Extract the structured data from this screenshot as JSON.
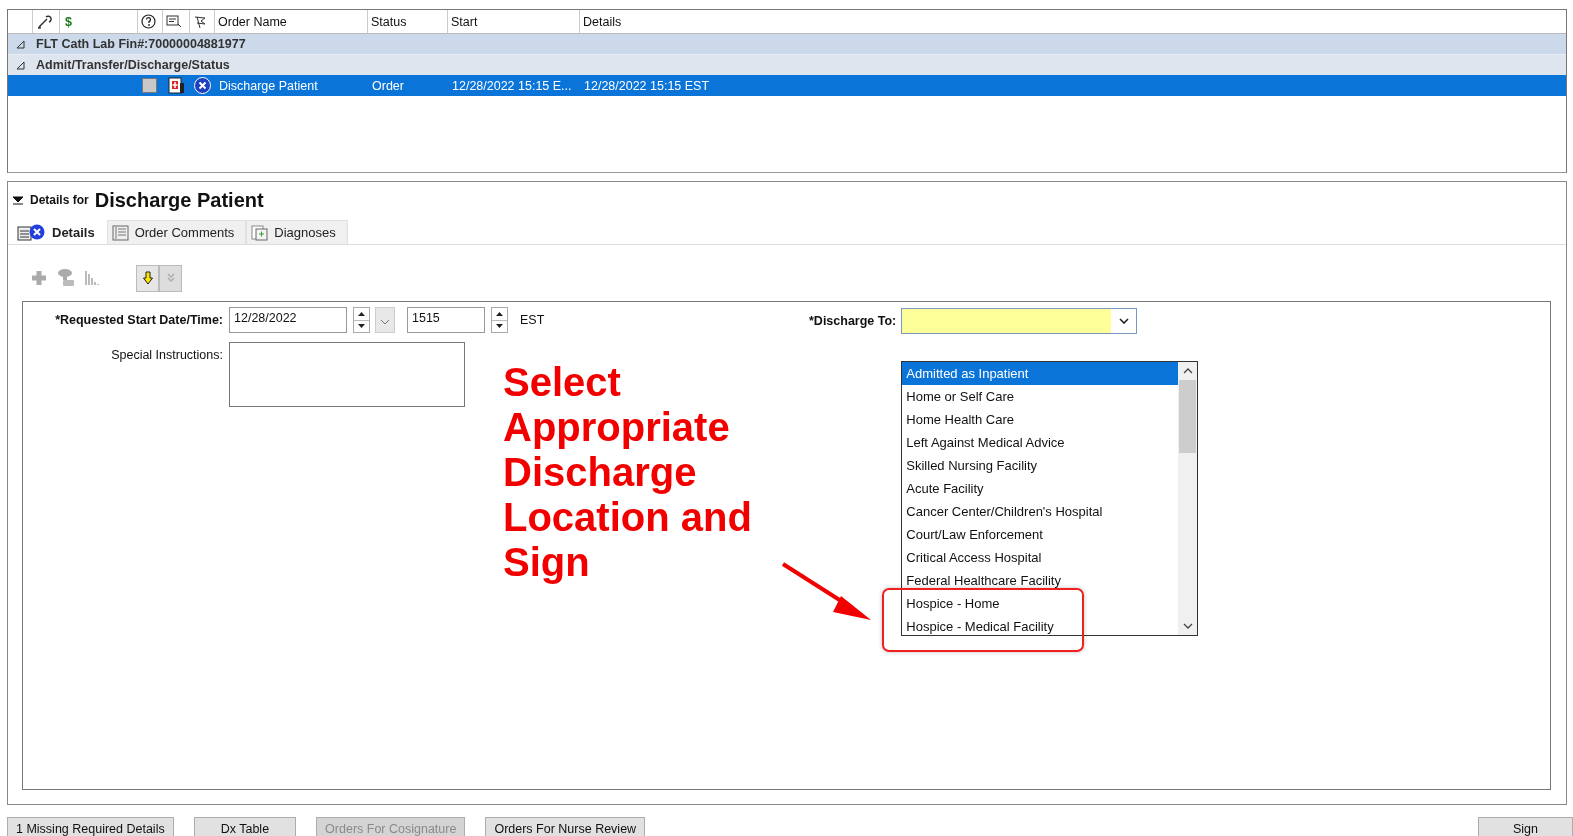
{
  "order_grid": {
    "columns": [
      {
        "label": "$",
        "kind": "money"
      },
      {
        "label": "Order Name",
        "kind": "text"
      },
      {
        "label": "Status",
        "kind": "text"
      },
      {
        "label": "Start",
        "kind": "text"
      },
      {
        "label": "Details",
        "kind": "text"
      }
    ],
    "groups": [
      {
        "label": "FLT Cath Lab  Fin#:70000004881977",
        "expanded": true,
        "kind": "encounter"
      },
      {
        "label": "Admit/Transfer/Discharge/Status",
        "expanded": true,
        "kind": "category"
      }
    ],
    "rows": [
      {
        "order_name": "Discharge Patient",
        "status": "Order",
        "start": "12/28/2022 15:15 E...",
        "details": "12/28/2022 15:15 EST",
        "selected": true,
        "checked": false
      }
    ]
  },
  "details": {
    "prefix": "Details for",
    "title": "Discharge Patient",
    "expanded": true,
    "tabs": [
      {
        "label": "Details",
        "selected": true,
        "kind": "details"
      },
      {
        "label": "Order Comments",
        "selected": false,
        "kind": "comments"
      },
      {
        "label": "Diagnoses",
        "selected": false,
        "kind": "diagnoses"
      }
    ],
    "start_label": "*Requested Start Date/Time:",
    "start_date": "12/28/2022",
    "start_time": "1515",
    "time_zone": "EST",
    "instructions_label": "Special Instructions:",
    "discharge_label": "*Discharge To:"
  },
  "discharge_list": [
    {
      "label": "Admitted as Inpatient",
      "selected": true
    },
    {
      "label": "Home or Self Care",
      "selected": false
    },
    {
      "label": "Home Health Care",
      "selected": false
    },
    {
      "label": "Left Against Medical Advice",
      "selected": false
    },
    {
      "label": "Skilled Nursing Facility",
      "selected": false
    },
    {
      "label": "Acute Facility",
      "selected": false
    },
    {
      "label": "Cancer Center/Children's Hospital",
      "selected": false
    },
    {
      "label": "Court/Law Enforcement",
      "selected": false
    },
    {
      "label": "Critical Access Hospital",
      "selected": false
    },
    {
      "label": "Federal Healthcare Facility",
      "selected": false
    },
    {
      "label": "Hospice - Home",
      "selected": false
    },
    {
      "label": "Hospice - Medical Facility",
      "selected": false
    }
  ],
  "annotation": "Select Appropriate Discharge Location and Sign",
  "footer_buttons": [
    {
      "label": "1 Missing Required Details",
      "disabled": false
    },
    {
      "label": "Dx Table",
      "disabled": false
    },
    {
      "label": "Orders For Cosignature",
      "disabled": true
    },
    {
      "label": "Orders For Nurse Review",
      "disabled": false
    }
  ],
  "sign_button": "Sign"
}
